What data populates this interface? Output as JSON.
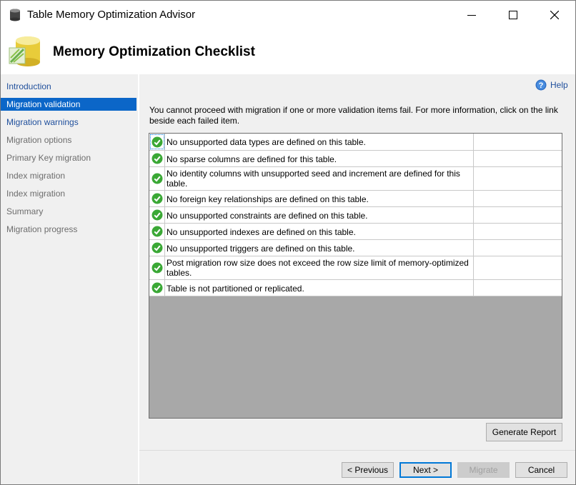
{
  "window": {
    "title": "Table Memory Optimization Advisor"
  },
  "header": {
    "title": "Memory Optimization Checklist"
  },
  "sidebar": {
    "items": [
      {
        "label": "Introduction",
        "state": "link"
      },
      {
        "label": "Migration validation",
        "state": "active"
      },
      {
        "label": "Migration warnings",
        "state": "link"
      },
      {
        "label": "Migration options",
        "state": "disabled"
      },
      {
        "label": "Primary Key migration",
        "state": "disabled"
      },
      {
        "label": "Index migration",
        "state": "disabled"
      },
      {
        "label": "Index migration",
        "state": "disabled"
      },
      {
        "label": "Summary",
        "state": "disabled"
      },
      {
        "label": "Migration progress",
        "state": "disabled"
      }
    ]
  },
  "main": {
    "help_label": "Help",
    "intro": "You cannot proceed with migration if one or more validation items fail. For more information, click on the link beside each failed item.",
    "checks": [
      {
        "status": "passed",
        "text": "No unsupported data types are defined on this table."
      },
      {
        "status": "passed",
        "text": "No sparse columns are defined for this table."
      },
      {
        "status": "passed",
        "text": "No identity columns with unsupported seed and increment are defined for this table."
      },
      {
        "status": "passed",
        "text": "No foreign key relationships are defined on this table."
      },
      {
        "status": "passed",
        "text": "No unsupported constraints are defined on this table."
      },
      {
        "status": "passed",
        "text": "No unsupported indexes are defined on this table."
      },
      {
        "status": "passed",
        "text": "No unsupported triggers are defined on this table."
      },
      {
        "status": "passed",
        "text": "Post migration row size does not exceed the row size limit of memory-optimized tables."
      },
      {
        "status": "passed",
        "text": "Table is not partitioned or replicated."
      }
    ],
    "generate_report_label": "Generate Report"
  },
  "footer": {
    "previous_label": "< Previous",
    "next_label": "Next >",
    "migrate_label": "Migrate",
    "cancel_label": "Cancel"
  },
  "icons": {
    "check": "check-circle-icon",
    "help": "help-icon",
    "app": "database-icon"
  },
  "colors": {
    "accent": "#0b66c8",
    "link": "#1f4f9c",
    "check_green": "#3aa835"
  }
}
